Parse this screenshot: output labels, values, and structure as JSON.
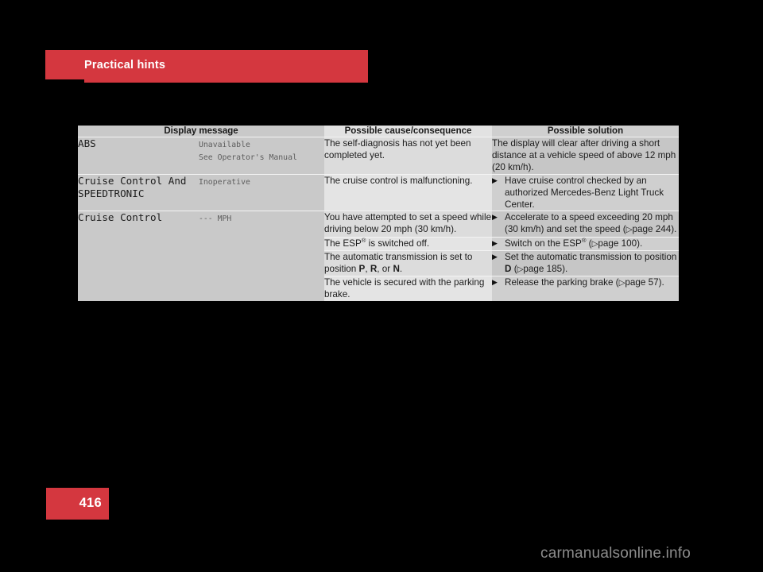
{
  "chapter": {
    "title": "Practical hints"
  },
  "page": {
    "number": "416",
    "watermark": "carmanualsonline.info"
  },
  "table": {
    "headers": {
      "display_message": "Display message",
      "possible_cause": "Possible cause/consequence",
      "possible_solution": "Possible solution"
    },
    "messages": [
      {
        "main": "ABS",
        "sub": "Unavailable\nSee Operator's Manual"
      },
      {
        "main": "Cruise Control And SPEEDTRONIC",
        "sub": "Inoperative"
      },
      {
        "main": "Cruise Control",
        "sub": "--- MPH"
      }
    ],
    "rows": [
      {
        "cause_pre": "The self-diagnosis has not yet been completed yet.",
        "cause_post": "",
        "solution_bullet": false,
        "solution_pre": "The display will clear after driving a short distance at a vehicle speed of above 12 mph (20 km/h).",
        "solution_post": ""
      },
      {
        "cause_pre": "The cruise control is malfunctioning.",
        "cause_post": "",
        "solution_bullet": true,
        "solution_pre": "Have cruise control checked by an authorized Mercedes-Benz Light Truck Center.",
        "solution_post": ""
      },
      {
        "cause_pre": "You have attempted to set a speed while driving below 20 mph (30 km/h).",
        "cause_post": "",
        "solution_bullet": true,
        "solution_pre": "Accelerate to a speed exceeding 20 mph (30 km/h) and set the speed (",
        "solution_ref": "page 244",
        "solution_post": ")."
      },
      {
        "cause_esp": true,
        "cause_pre": "The ESP",
        "cause_post": " is switched off.",
        "solution_bullet": true,
        "solution_esp": true,
        "solution_pre": "Switch on the ESP",
        "solution_mid": " (",
        "solution_ref": "page 100",
        "solution_post": ")."
      },
      {
        "cause_pre": "The automatic transmission is set to position ",
        "cause_gears": [
          "P",
          "R",
          "N"
        ],
        "cause_sep1": ", ",
        "cause_sep2": ", or ",
        "cause_post": ".",
        "solution_bullet": true,
        "solution_pre": "Set the automatic transmission to position ",
        "solution_gear": "D",
        "solution_mid": " (",
        "solution_ref": "page 185",
        "solution_post": ")."
      },
      {
        "cause_pre": "The vehicle is secured with the parking brake.",
        "cause_post": "",
        "solution_bullet": true,
        "solution_pre": "Release the parking brake (",
        "solution_ref": "page 57",
        "solution_post": ")."
      }
    ],
    "icons": {
      "bullet": "▶",
      "page_ref": "▷"
    }
  }
}
